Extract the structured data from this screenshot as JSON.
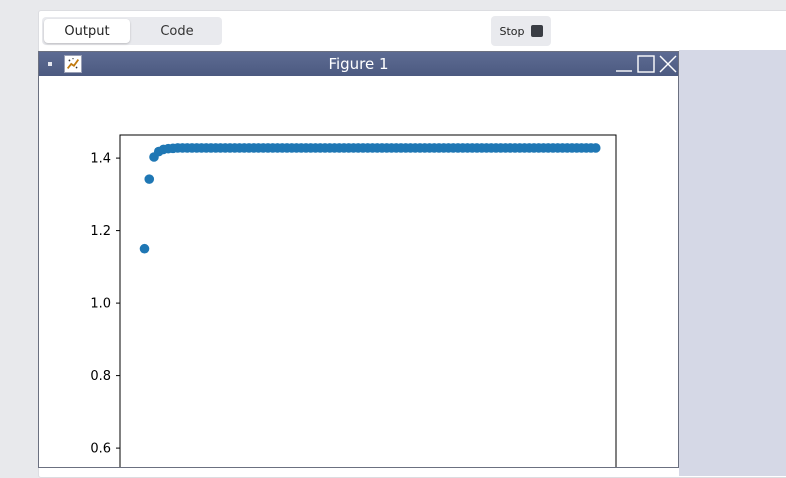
{
  "tabs": {
    "output_label": "Output",
    "code_label": "Code"
  },
  "stop": {
    "label": "Stop"
  },
  "figure": {
    "title": "Figure 1",
    "icons": [
      "figure-app-icon",
      "minimize-icon",
      "maximize-icon",
      "close-icon"
    ]
  },
  "colors": {
    "marker": "#1f77b4",
    "titlebar": "#55648a",
    "side_panel": "#d5d8e6"
  },
  "chart_data": {
    "type": "scatter",
    "yticks": [
      "0.6",
      "0.8",
      "1.0",
      "1.2",
      "1.4"
    ],
    "ytick_values": [
      0.6,
      0.8,
      1.0,
      1.2,
      1.4
    ],
    "ylim": [
      0.55,
      1.475
    ],
    "xlim": [
      -2.5,
      101.5
    ],
    "points": {
      "x_start": 0,
      "x_end": 95,
      "y_values": [
        1.15,
        1.342,
        1.403,
        1.418,
        1.424,
        1.426,
        1.427,
        1.428
      ],
      "y_tail": 1.428
    }
  }
}
